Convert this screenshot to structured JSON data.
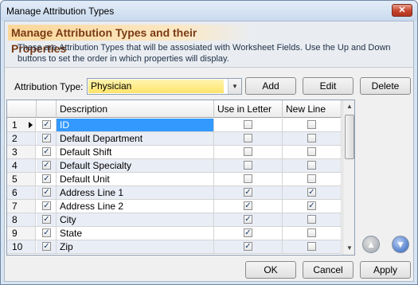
{
  "window": {
    "title": "Manage Attribution Types",
    "close_symbol": "✕"
  },
  "header": {
    "title": "Manage Attribution Types and their Properties",
    "description": "These are Attribution Types that will be assosiated with Worksheet Fields. Use the Up and Down buttons to set the order in which properties will display."
  },
  "type_selector": {
    "label": "Attribution Type:",
    "value": "Physician"
  },
  "actions": {
    "add": "Add",
    "edit": "Edit",
    "delete": "Delete"
  },
  "grid": {
    "columns": {
      "description": "Description",
      "use_in_letter": "Use in Letter",
      "new_line": "New Line"
    },
    "rows": [
      {
        "num": "1",
        "enabled": true,
        "description": "ID",
        "use_in_letter": false,
        "new_line": false,
        "selected": true
      },
      {
        "num": "2",
        "enabled": true,
        "description": "Default Department",
        "use_in_letter": false,
        "new_line": false
      },
      {
        "num": "3",
        "enabled": true,
        "description": "Default Shift",
        "use_in_letter": false,
        "new_line": false
      },
      {
        "num": "4",
        "enabled": true,
        "description": "Default Specialty",
        "use_in_letter": false,
        "new_line": false
      },
      {
        "num": "5",
        "enabled": true,
        "description": "Default Unit",
        "use_in_letter": false,
        "new_line": false
      },
      {
        "num": "6",
        "enabled": true,
        "description": "Address Line 1",
        "use_in_letter": true,
        "new_line": true
      },
      {
        "num": "7",
        "enabled": true,
        "description": "Address Line 2",
        "use_in_letter": true,
        "new_line": true
      },
      {
        "num": "8",
        "enabled": true,
        "description": "City",
        "use_in_letter": true,
        "new_line": false
      },
      {
        "num": "9",
        "enabled": true,
        "description": "State",
        "use_in_letter": true,
        "new_line": false
      },
      {
        "num": "10",
        "enabled": true,
        "description": "Zip",
        "use_in_letter": true,
        "new_line": false
      }
    ]
  },
  "move": {
    "up_icon": "arrow-up-icon",
    "down_icon": "arrow-down-icon"
  },
  "footer": {
    "ok": "OK",
    "cancel": "Cancel",
    "apply": "Apply"
  }
}
